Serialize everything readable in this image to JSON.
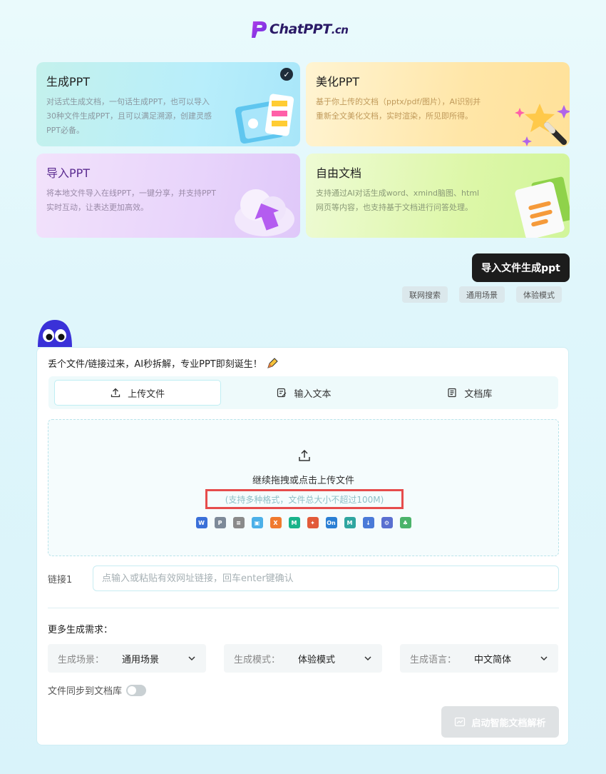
{
  "brand": {
    "name": "ChatPPT",
    "domain": ".cn"
  },
  "cards": [
    {
      "title": "生成PPT",
      "desc": "对话式生成文档，一句话生成PPT，也可以导入30种文件生成PPT，且可以满足溯源，创建灵感PPT必备。",
      "selected": true
    },
    {
      "title": "美化PPT",
      "desc": "基于你上传的文档（pptx/pdf/图片），AI识别并重新全文美化文档，实时渲染，所见即所得。"
    },
    {
      "title": "导入PPT",
      "desc": "将本地文件导入在线PPT，一键分享，并支持PPT实时互动，让表达更加高效。"
    },
    {
      "title": "自由文档",
      "desc": "支持通过AI对话生成word、xmind脑图、html网页等内容，也支持基于文档进行问答处理。"
    }
  ],
  "import_button": "导入文件生成ppt",
  "chips": [
    "联网搜索",
    "通用场景",
    "体验模式"
  ],
  "panel": {
    "intro": "丢个文件/链接过来，AI秒拆解，专业PPT即刻诞生！",
    "tabs": [
      {
        "label": "上传文件",
        "icon": "upload-icon",
        "active": true
      },
      {
        "label": "输入文本",
        "icon": "edit-icon"
      },
      {
        "label": "文档库",
        "icon": "document-icon"
      }
    ],
    "dropzone": {
      "main": "继续拖拽或点击上传文件",
      "sub": "(支持多种格式，文件总大小不超过100M)"
    },
    "formats": [
      {
        "icon": "word-icon",
        "color": "#3a6fd8",
        "glyph": "W"
      },
      {
        "icon": "ppt-icon",
        "color": "#7d8a99",
        "glyph": "P"
      },
      {
        "icon": "pdf-icon",
        "color": "#8a8a8a",
        "glyph": "≡"
      },
      {
        "icon": "image-icon",
        "color": "#4cb0e8",
        "glyph": "▣"
      },
      {
        "icon": "xmind-icon",
        "color": "#f07a2e",
        "glyph": "X"
      },
      {
        "icon": "mindmap-icon",
        "color": "#18b38a",
        "glyph": "M"
      },
      {
        "icon": "butterfly-icon",
        "color": "#e25b3a",
        "glyph": "✦"
      },
      {
        "icon": "onenote-icon",
        "color": "#2a7fd4",
        "glyph": "On"
      },
      {
        "icon": "markdown-icon",
        "color": "#2fa6a0",
        "glyph": "M"
      },
      {
        "icon": "download-icon",
        "color": "#4a7ad8",
        "glyph": "↓"
      },
      {
        "icon": "link-icon",
        "color": "#5a6fd0",
        "glyph": "⚙"
      },
      {
        "icon": "audio-icon",
        "color": "#4bb36a",
        "glyph": "♣"
      }
    ],
    "link": {
      "label": "链接1",
      "placeholder": "点输入或粘贴有效网址链接，回车enter键确认"
    },
    "more_label": "更多生成需求：",
    "selects": [
      {
        "label": "生成场景：",
        "value": "通用场景"
      },
      {
        "label": "生成模式：",
        "value": "体验模式"
      },
      {
        "label": "生成语言：",
        "value": "中文简体"
      }
    ],
    "sync_label": "文件同步到文档库",
    "start_button": "启动智能文档解析"
  }
}
